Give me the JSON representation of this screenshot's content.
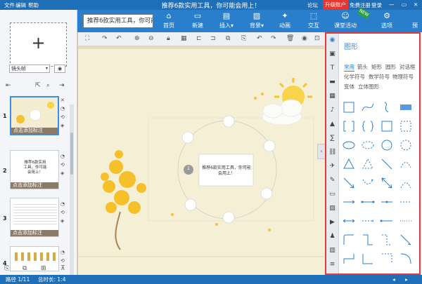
{
  "menu": {
    "file": "文件",
    "edit": "编辑",
    "help": "帮助",
    "forum": "论坛",
    "upgrade": "升级账户",
    "register": "免费注册",
    "login": "登录"
  },
  "window_title": "推荐6款实用工具，你可能会用上！",
  "notice_text": "推荐6款实用工具，你可能会用上！",
  "toolbar": [
    {
      "label": "首页",
      "icon": "home-icon",
      "glyph": "⌂"
    },
    {
      "label": "新建",
      "icon": "new-icon",
      "glyph": "▭"
    },
    {
      "label": "插入▾",
      "icon": "insert-icon",
      "glyph": "▤"
    },
    {
      "label": "背景▾",
      "icon": "background-icon",
      "glyph": "▨"
    },
    {
      "label": "动画",
      "icon": "animation-icon",
      "glyph": "✦"
    },
    {
      "label": "交互",
      "icon": "interaction-icon",
      "glyph": "⬚"
    },
    {
      "label": "课堂活动",
      "icon": "classroom-activity-icon",
      "glyph": "☺"
    },
    {
      "label": "选项",
      "icon": "options-icon",
      "glyph": "⚙"
    },
    {
      "label": "预",
      "icon": "preview-icon",
      "glyph": ""
    }
  ],
  "new_badge": "NEW",
  "left": {
    "lens_frame": "镜头帧",
    "lens_arrow": "▾",
    "camera_glyph": "◉",
    "add_glyph": "+",
    "slides": [
      {
        "num": "1",
        "label": "点击添加标注"
      },
      {
        "num": "2",
        "label": "点击添加标注",
        "title": "推荐6款实用工具，你可能会用上！"
      },
      {
        "num": "3",
        "label": "点击添加标注"
      },
      {
        "num": "4",
        "label": ""
      }
    ]
  },
  "canvas": {
    "center_text": "推荐6款实用工具，你可能会用上！",
    "center_num": "1"
  },
  "right": {
    "title": "图形",
    "tabs_row1": [
      "常用",
      "箭头",
      "矩形",
      "圆形",
      "对话框"
    ],
    "tabs_row2": [
      "化学符号",
      "数学符号",
      "物理符号"
    ],
    "tabs_row3": [
      "变体",
      "立体图形"
    ]
  },
  "status": {
    "path": "路径 1/11",
    "time": "总时长: 1:4"
  },
  "colors": {
    "accent": "#2a7fcc",
    "highlight_border": "#e03b3b",
    "upgrade": "#e8362e"
  }
}
